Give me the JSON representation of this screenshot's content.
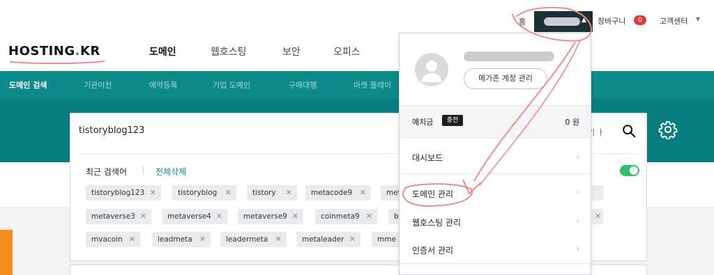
{
  "top_bar": {
    "home": "홈",
    "cart_label": "장바구니",
    "cart_count": "0",
    "support": "고객센터"
  },
  "brand": {
    "logo_left": "HOSTING",
    "logo_dot": ".",
    "logo_right": "KR"
  },
  "main_nav": {
    "items": [
      "도메인",
      "웹호스팅",
      "보안",
      "오피스"
    ]
  },
  "sub_nav": {
    "items": [
      "도메인 검색",
      "기관이전",
      "예약등록",
      "기업 도메인",
      "구매대행",
      "마켓 플레이"
    ]
  },
  "search": {
    "query": "tistoryblog123",
    "hint": "기 ㅏ",
    "recent_label": "최근 검색어",
    "delete_all": "전체삭제"
  },
  "recent_chips": [
    [
      "tistoryblog123",
      "tistoryblog",
      "tistory",
      "metacode9",
      "met"
    ],
    [
      "metaverse3",
      "metaverse4",
      "metaverse9",
      "coinmeta9",
      "b"
    ],
    [
      "mvacoin",
      "leadmeta",
      "leadermeta",
      "metaleader",
      "mme"
    ]
  ],
  "dropdown": {
    "account_button": "메가존 계정 관리",
    "balance_label": "예치금",
    "charge_label": "충전",
    "balance_value": "0 원",
    "menu": [
      "대시보드",
      "도메인 관리",
      "웹호스팅 관리",
      "인증서 관리"
    ]
  },
  "colors": {
    "teal": "#0d8a8c",
    "hero": "#087e80",
    "badge_red": "#e23a3a",
    "toggle_green": "#2fbf6b",
    "annotation_pink": "#f08a8a"
  }
}
